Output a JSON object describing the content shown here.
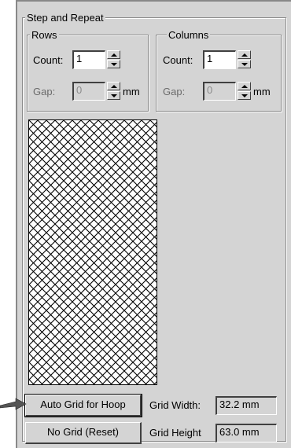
{
  "step_and_repeat": {
    "title": "Step and Repeat",
    "rows": {
      "title": "Rows",
      "count_label": "Count:",
      "count_value": "1",
      "gap_label": "Gap:",
      "gap_value": "0",
      "gap_unit": "mm"
    },
    "columns": {
      "title": "Columns",
      "count_label": "Count:",
      "count_value": "1",
      "gap_label": "Gap:",
      "gap_value": "0",
      "gap_unit": "mm"
    },
    "auto_grid_button": "Auto Grid for Hoop",
    "no_grid_button": "No Grid (Reset)",
    "grid_width_label": "Grid Width:",
    "grid_width_value": "32.2 mm",
    "grid_height_label": "Grid Height",
    "grid_height_value": "63.0 mm"
  },
  "colors": {
    "dialog_background": "#d4d4d4",
    "preview_pattern": "#000000",
    "pointer_arrow": "#555555"
  },
  "icons": [
    "spin-up-icon",
    "spin-down-icon",
    "pointer-arrow-icon"
  ]
}
